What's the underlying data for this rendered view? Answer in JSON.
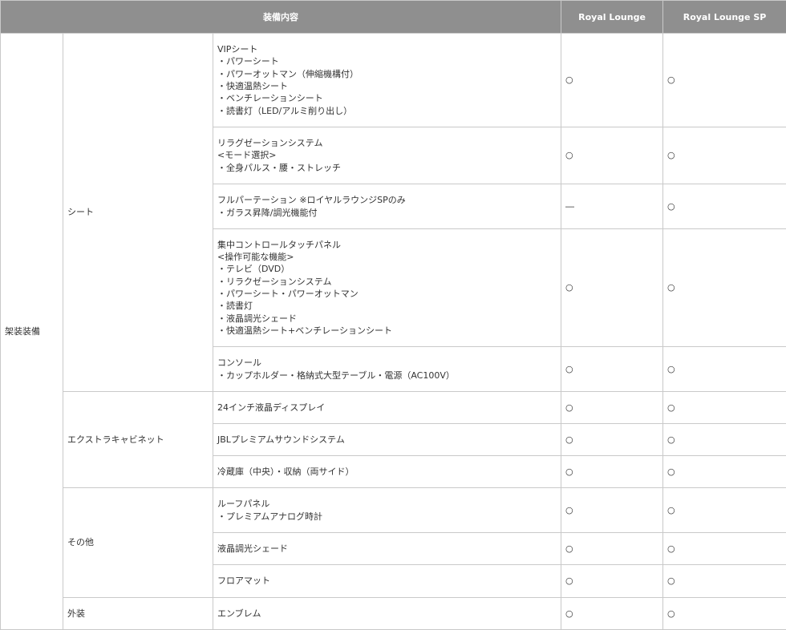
{
  "header": {
    "equipment": "装備内容",
    "royal_lounge": "Royal Lounge",
    "royal_lounge_sp": "Royal Lounge SP"
  },
  "category": "架装装備",
  "groups": {
    "seat": "シート",
    "extra_cabinet": "エクストラキャビネット",
    "other": "その他",
    "exterior": "外装"
  },
  "rows": [
    {
      "desc": "VIPシート\n・パワーシート\n・パワーオットマン（伸縮機構付）\n・快適温熱シート\n・ベンチレーションシート\n・読書灯（LED/アルミ削り出し）",
      "rl": "○",
      "rlsp": "○"
    },
    {
      "desc": "リラグゼーションシステム\n<モード選択>\n・全身パルス・腰・ストレッチ",
      "rl": "○",
      "rlsp": "○"
    },
    {
      "desc": "フルパーテーション ※ロイヤルラウンジSPのみ\n・ガラス昇降/調光機能付",
      "rl": "―",
      "rlsp": "○"
    },
    {
      "desc": "集中コントロールタッチパネル\n<操作可能な機能>\n・テレビ（DVD）\n・リラクゼーションシステム\n・パワーシート・パワーオットマン\n・読書灯\n・液晶調光シェード\n・快適温熱シート+ベンチレーションシート",
      "rl": "○",
      "rlsp": "○"
    },
    {
      "desc": "コンソール\n・カップホルダー・格納式大型テーブル・電源（AC100V）",
      "rl": "○",
      "rlsp": "○"
    },
    {
      "desc": "24インチ液晶ディスプレイ",
      "rl": "○",
      "rlsp": "○"
    },
    {
      "desc": "JBLプレミアムサウンドシステム",
      "rl": "○",
      "rlsp": "○"
    },
    {
      "desc": "冷蔵庫（中央）・収納（両サイド）",
      "rl": "○",
      "rlsp": "○"
    },
    {
      "desc": "ルーフパネル\n・プレミアムアナログ時計",
      "rl": "○",
      "rlsp": "○"
    },
    {
      "desc": "液晶調光シェード",
      "rl": "○",
      "rlsp": "○"
    },
    {
      "desc": "フロアマット",
      "rl": "○",
      "rlsp": "○"
    },
    {
      "desc": "エンブレム",
      "rl": "○",
      "rlsp": "○"
    }
  ]
}
